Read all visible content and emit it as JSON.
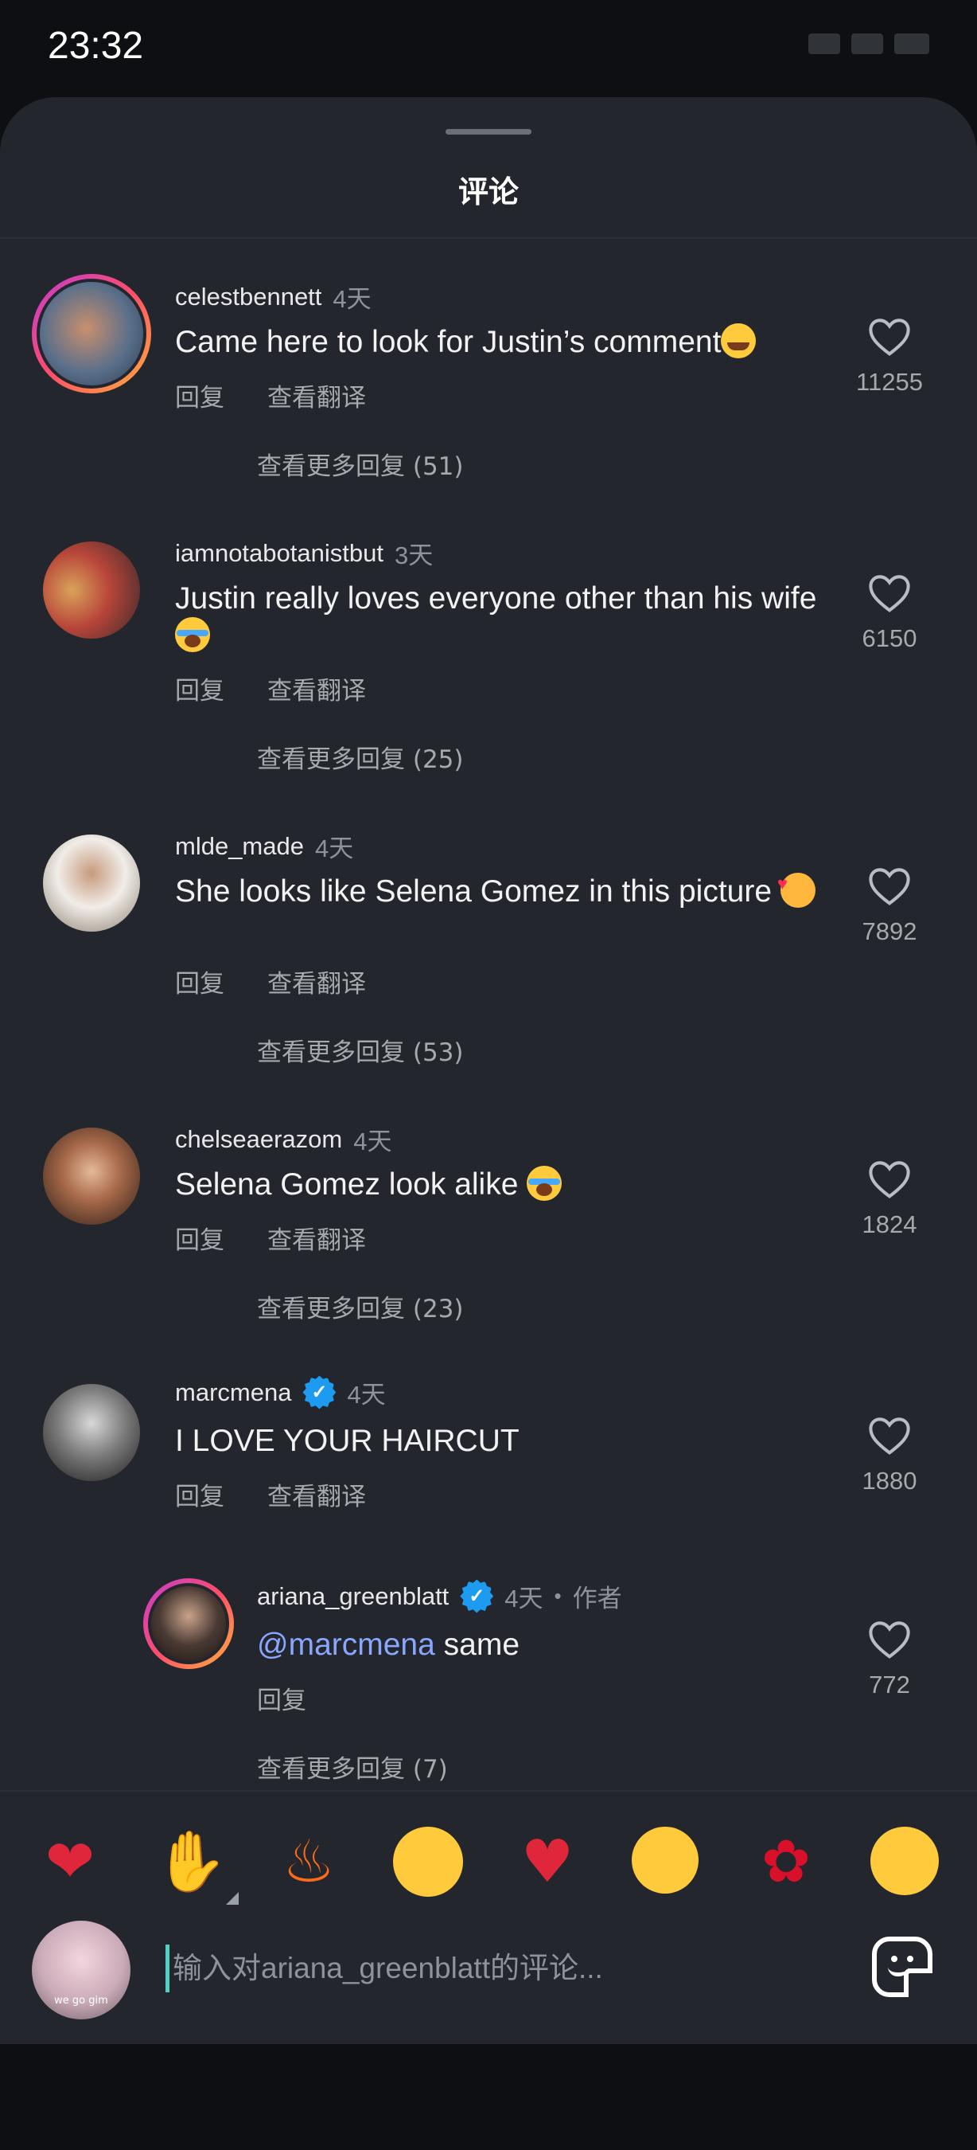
{
  "status_bar": {
    "time": "23:32"
  },
  "sheet": {
    "title": "评论"
  },
  "labels": {
    "reply": "回复",
    "translate": "查看翻译"
  },
  "comments": [
    {
      "username": "celestbennett",
      "time": "4天",
      "text": "Came here to look for Justin’s comment",
      "emoji": "laugh-cry-emoji",
      "likes": "11255",
      "more_replies": "查看更多回复 (51)"
    },
    {
      "username": "iamnotabotanistbut",
      "time": "3天",
      "text": "Justin really loves everyone other  than his wife",
      "emoji": "crying-emoji",
      "likes": "6150",
      "more_replies": "查看更多回复 (25)"
    },
    {
      "username": "mlde_made",
      "time": "4天",
      "text": "She looks like Selena Gomez in this picture",
      "emoji": "smiling-hearts-emoji",
      "likes": "7892",
      "more_replies": "查看更多回复 (53)"
    },
    {
      "username": "chelseaerazom",
      "time": "4天",
      "text": "Selena Gomez look alike ",
      "emoji": "crying-emoji",
      "likes": "1824",
      "more_replies": "查看更多回复 (23)"
    },
    {
      "username": "marcmena",
      "verified": true,
      "time": "4天",
      "text": "I LOVE YOUR HAIRCUT",
      "likes": "1880"
    }
  ],
  "reply": {
    "username": "ariana_greenblatt",
    "verified": true,
    "time": "4天",
    "dot": "•",
    "author_badge": "作者",
    "mention": "@marcmena",
    "text": " same",
    "likes": "772",
    "more_replies": "查看更多回复 (7)"
  },
  "quick_emojis": [
    "red-heart",
    "raising-hands",
    "fire",
    "loudly-crying",
    "broken-heart",
    "heart-eyes",
    "rose",
    "tears-of-joy"
  ],
  "input": {
    "placeholder": "输入对ariana_greenblatt的评论...",
    "avatar_caption": "we go gim"
  },
  "colors": {
    "sheet_bg": "#23262c",
    "page_bg": "#0d0f13",
    "mention": "#8aa7ff",
    "verified": "#1d9bf0",
    "cursor": "#4fd1c5"
  }
}
